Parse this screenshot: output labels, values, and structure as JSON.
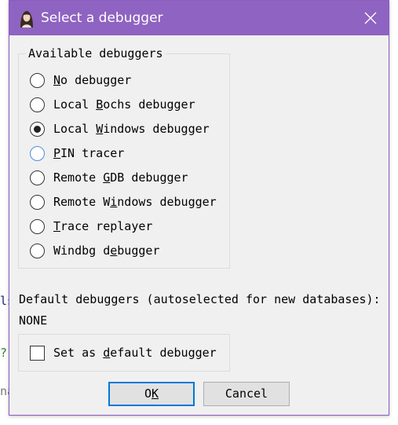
{
  "background_fragments": [
    "ls",
    "?",
    "na"
  ],
  "dialog": {
    "title": "Select a debugger",
    "available_group": {
      "legend": "Available debuggers",
      "options": [
        {
          "pre": "",
          "key": "N",
          "post": "o debugger",
          "selected": false,
          "focused": false
        },
        {
          "pre": "Local ",
          "key": "B",
          "post": "ochs debugger",
          "selected": false,
          "focused": false
        },
        {
          "pre": "Local ",
          "key": "W",
          "post": "indows debugger",
          "selected": true,
          "focused": false
        },
        {
          "pre": "",
          "key": "P",
          "post": "IN tracer",
          "selected": false,
          "focused": true
        },
        {
          "pre": "Remote ",
          "key": "G",
          "post": "DB debugger",
          "selected": false,
          "focused": false
        },
        {
          "pre": "Remote W",
          "key": "i",
          "post": "ndows debugger",
          "selected": false,
          "focused": false
        },
        {
          "pre": "",
          "key": "T",
          "post": "race replayer",
          "selected": false,
          "focused": false
        },
        {
          "pre": "Windbg d",
          "key": "e",
          "post": "bugger",
          "selected": false,
          "focused": false
        }
      ]
    },
    "default_label": "Default debuggers (autoselected for new databases):",
    "default_value": "NONE",
    "set_default": {
      "pre": "Set as ",
      "key": "d",
      "post": "efault debugger",
      "checked": false
    },
    "ok_button": {
      "pre": "O",
      "key": "K",
      "post": ""
    },
    "cancel_button": {
      "label": "Cancel"
    }
  },
  "colors": {
    "titlebar": "#8f63c1",
    "window_bg": "#f0f0f0",
    "focus_blue": "#0078d7"
  },
  "icons": {
    "app": "ida-avatar-icon",
    "close": "close-icon"
  }
}
